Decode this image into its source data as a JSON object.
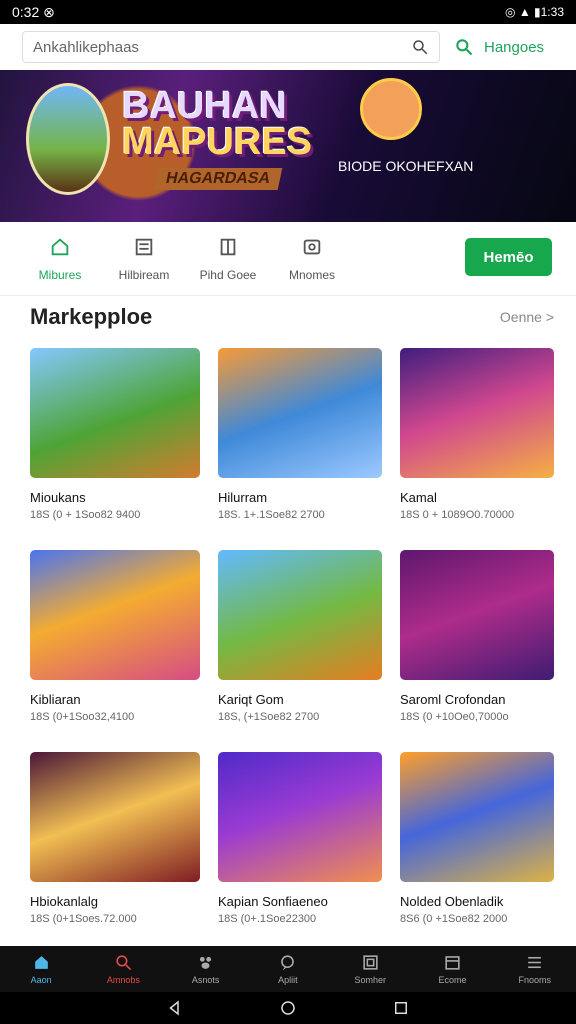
{
  "status": {
    "time": "0:32 ⊗",
    "right": "◎ ▲ ▮1:33"
  },
  "search": {
    "placeholder": "Ankahlikephaas",
    "green": "Hangoes"
  },
  "banner": {
    "title_top": "BAUHAN",
    "title_main": "MAPURES",
    "subtitle": "HAGARDASA",
    "right_text": "BIODE OKOHEFXAN"
  },
  "tabs": [
    {
      "label": "Mibures"
    },
    {
      "label": "Hilbiream"
    },
    {
      "label": "Pihd Goee"
    },
    {
      "label": "Mnomes"
    }
  ],
  "home_button": "Hemēo",
  "section": {
    "title": "Markepploe",
    "link": "Oenne >"
  },
  "cards": [
    {
      "title": "Mioukans",
      "meta": "18S (0 + 1Soo82 9400"
    },
    {
      "title": "Hilurram",
      "meta": "18S. 1+.1Soe82 2700"
    },
    {
      "title": "Kamal",
      "meta": "18S 0 + 1089O0.70000"
    },
    {
      "title": "Kibliaran",
      "meta": "18S (0+1Soo32,4100"
    },
    {
      "title": "Kariqt Gom",
      "meta": "18S, (+1Soe82 2700"
    },
    {
      "title": "Saroml Crofondan",
      "meta": "18S (0 +10Oe0,7000o"
    },
    {
      "title": "Hbiokanlalg",
      "meta": "18S (0+1Soes.72.000"
    },
    {
      "title": "Kapian Sonfiaeneo",
      "meta": "18S (0+.1Soe22300"
    },
    {
      "title": "Nolded Obenladik",
      "meta": "8S6 (0 +1Soe82 2000"
    }
  ],
  "nav": [
    {
      "label": "Aaon"
    },
    {
      "label": "Amnobs"
    },
    {
      "label": "Asnots"
    },
    {
      "label": "Apliit"
    },
    {
      "label": "Somher"
    },
    {
      "label": "Ecome"
    },
    {
      "label": "Fnooms"
    }
  ]
}
